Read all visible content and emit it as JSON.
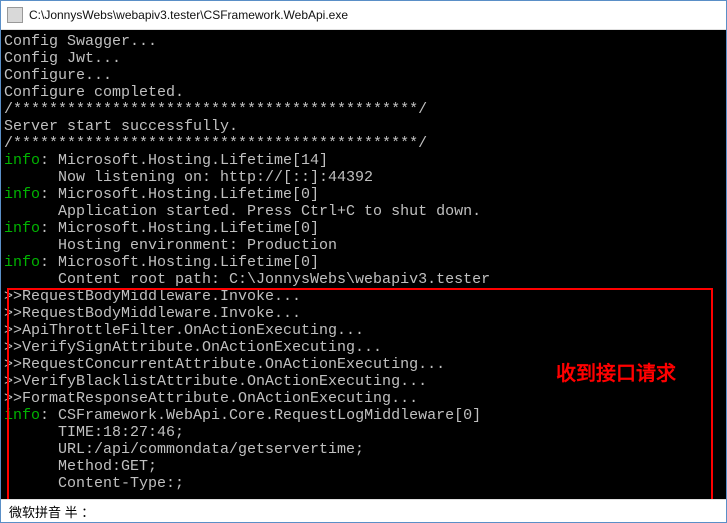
{
  "window": {
    "title": "C:\\JonnysWebs\\webapiv3.tester\\CSFramework.WebApi.exe"
  },
  "annotation": "收到接口请求",
  "ime": "微软拼音 半 ：",
  "lines": [
    {
      "segs": [
        {
          "t": "Config Swagger...",
          "c": "white"
        }
      ]
    },
    {
      "segs": [
        {
          "t": "Config Jwt...",
          "c": "white"
        }
      ]
    },
    {
      "segs": [
        {
          "t": "Configure...",
          "c": "white"
        }
      ]
    },
    {
      "segs": [
        {
          "t": "Configure completed.",
          "c": "white"
        }
      ]
    },
    {
      "segs": [
        {
          "t": "/*********************************************/",
          "c": "white"
        }
      ]
    },
    {
      "segs": [
        {
          "t": "Server start successfully.",
          "c": "white"
        }
      ]
    },
    {
      "segs": [
        {
          "t": "/*********************************************/",
          "c": "white"
        }
      ]
    },
    {
      "segs": [
        {
          "t": "info",
          "c": "green"
        },
        {
          "t": ": Microsoft.Hosting.Lifetime[14]",
          "c": "white"
        }
      ]
    },
    {
      "segs": [
        {
          "t": "      Now listening on: http://[::]:44392",
          "c": "white"
        }
      ]
    },
    {
      "segs": [
        {
          "t": "info",
          "c": "green"
        },
        {
          "t": ": Microsoft.Hosting.Lifetime[0]",
          "c": "white"
        }
      ]
    },
    {
      "segs": [
        {
          "t": "      Application started. Press Ctrl+C to shut down.",
          "c": "white"
        }
      ]
    },
    {
      "segs": [
        {
          "t": "info",
          "c": "green"
        },
        {
          "t": ": Microsoft.Hosting.Lifetime[0]",
          "c": "white"
        }
      ]
    },
    {
      "segs": [
        {
          "t": "      Hosting environment: Production",
          "c": "white"
        }
      ]
    },
    {
      "segs": [
        {
          "t": "info",
          "c": "green"
        },
        {
          "t": ": Microsoft.Hosting.Lifetime[0]",
          "c": "white"
        }
      ]
    },
    {
      "segs": [
        {
          "t": "      Content root path: C:\\JonnysWebs\\webapiv3.tester",
          "c": "white"
        }
      ]
    },
    {
      "segs": [
        {
          "t": ">>RequestBodyMiddleware.Invoke...",
          "c": "white"
        }
      ]
    },
    {
      "segs": [
        {
          "t": ">>RequestBodyMiddleware.Invoke...",
          "c": "white"
        }
      ]
    },
    {
      "segs": [
        {
          "t": ">>ApiThrottleFilter.OnActionExecuting...",
          "c": "white"
        }
      ]
    },
    {
      "segs": [
        {
          "t": ">>VerifySignAttribute.OnActionExecuting...",
          "c": "white"
        }
      ]
    },
    {
      "segs": [
        {
          "t": ">>RequestConcurrentAttribute.OnActionExecuting...",
          "c": "white"
        }
      ]
    },
    {
      "segs": [
        {
          "t": ">>VerifyBlacklistAttribute.OnActionExecuting...",
          "c": "white"
        }
      ]
    },
    {
      "segs": [
        {
          "t": ">>FormatResponseAttribute.OnActionExecuting...",
          "c": "white"
        }
      ]
    },
    {
      "segs": [
        {
          "t": "info",
          "c": "green"
        },
        {
          "t": ": CSFramework.WebApi.Core.RequestLogMiddleware[0]",
          "c": "white"
        }
      ]
    },
    {
      "segs": [
        {
          "t": "      TIME:18:27:46;",
          "c": "white"
        }
      ]
    },
    {
      "segs": [
        {
          "t": "      URL:/api/commondata/getservertime;",
          "c": "white"
        }
      ]
    },
    {
      "segs": [
        {
          "t": "      Method:GET;",
          "c": "white"
        }
      ]
    },
    {
      "segs": [
        {
          "t": "      Content-Type:;",
          "c": "white"
        }
      ]
    }
  ]
}
